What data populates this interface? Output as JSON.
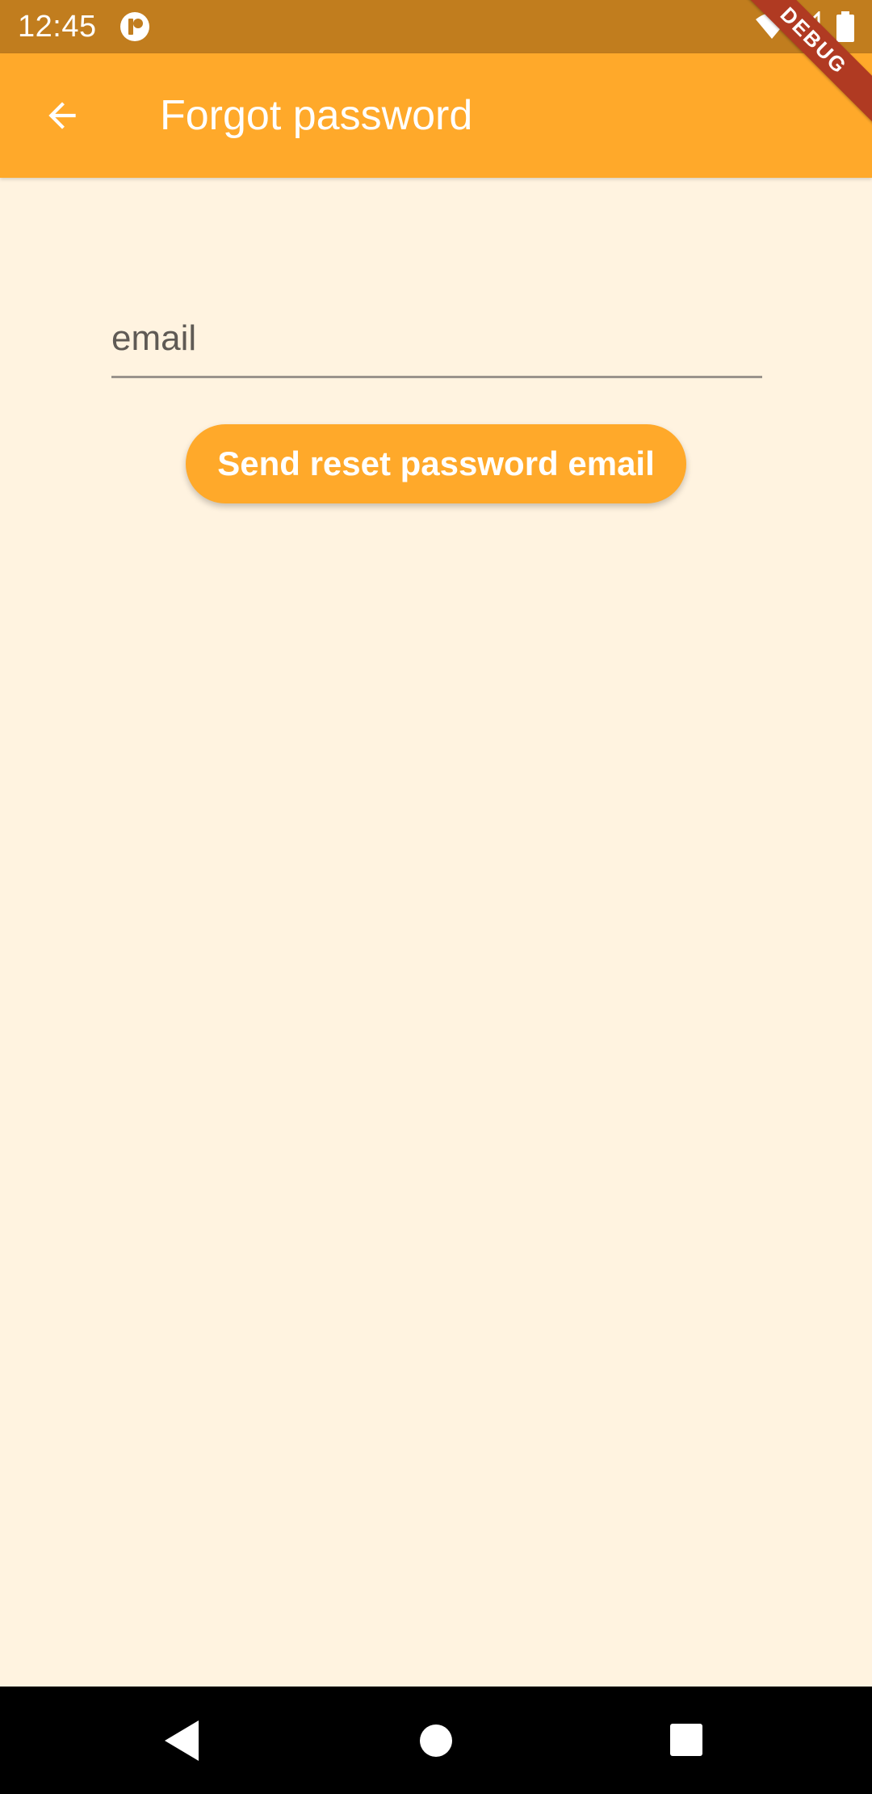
{
  "status_bar": {
    "time": "12:45",
    "icons": [
      "app-notification-icon",
      "wifi-icon",
      "signal-icon",
      "battery-icon"
    ]
  },
  "debug_banner": "DEBUG",
  "app_bar": {
    "back_icon": "arrow-back-icon",
    "title": "Forgot password",
    "background_color": "#FFA92A"
  },
  "form": {
    "email_placeholder": "email",
    "email_value": "",
    "submit_label": "Send reset password email"
  },
  "nav_bar": {
    "icons": [
      "back-triangle-icon",
      "home-circle-icon",
      "recents-square-icon"
    ]
  },
  "colors": {
    "accent": "#FFA92A",
    "status_bar": "#C17D1E",
    "background": "#FFF3E0",
    "debug_ribbon": "#B03A22"
  }
}
